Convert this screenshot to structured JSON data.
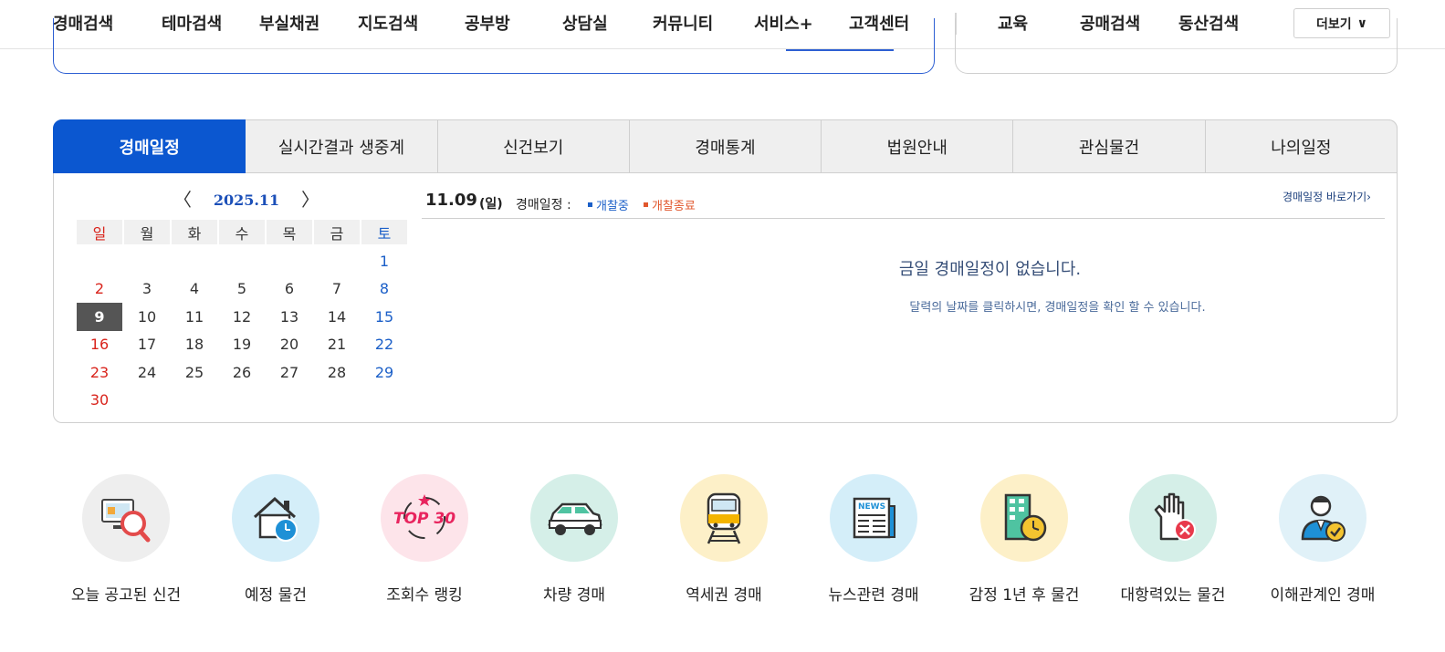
{
  "nav": {
    "items": [
      "경매검색",
      "테마검색",
      "부실채권",
      "지도검색",
      "공부방",
      "상담실",
      "커뮤니티",
      "서비스+",
      "고객센터"
    ],
    "extra": [
      "교육",
      "공매검색",
      "동산검색"
    ],
    "more_label": "더보기",
    "more_chevron": "∨"
  },
  "tabs": [
    "경매일정",
    "실시간결과 생중계",
    "신건보기",
    "경매통계",
    "법원안내",
    "관심물건",
    "나의일정"
  ],
  "active_tab": 0,
  "calendar": {
    "prev": "〈",
    "next": "〉",
    "month": "2025.11",
    "dow": [
      "일",
      "월",
      "화",
      "수",
      "목",
      "금",
      "토"
    ],
    "weeks": [
      [
        "",
        "",
        "",
        "",
        "",
        "",
        "1"
      ],
      [
        "2",
        "3",
        "4",
        "5",
        "6",
        "7",
        "8"
      ],
      [
        "9",
        "10",
        "11",
        "12",
        "13",
        "14",
        "15"
      ],
      [
        "16",
        "17",
        "18",
        "19",
        "20",
        "21",
        "22"
      ],
      [
        "23",
        "24",
        "25",
        "26",
        "27",
        "28",
        "29"
      ],
      [
        "30",
        "",
        "",
        "",
        "",
        "",
        ""
      ]
    ],
    "selected": "9"
  },
  "schedule": {
    "date": "11.09",
    "dow": "(일)",
    "label": "경매일정 :",
    "legend_open": "개찰중",
    "legend_closed": "개찰종료",
    "goto_link": "경매일정 바로가기›",
    "empty_title": "금일 경매일정이 없습니다.",
    "empty_sub": "달력의 날짜를 클릭하시면, 경매일정을 확인 할 수 있습니다."
  },
  "quick": [
    {
      "label": "오늘 공고된 신건",
      "icon": "monitor-search-icon",
      "bg": "#eeeeee"
    },
    {
      "label": "예정 물건",
      "icon": "house-clock-icon",
      "bg": "#d4eef9"
    },
    {
      "label": "조회수 랭킹",
      "icon": "top30-icon",
      "bg": "#fde4ea",
      "icon_text": "TOP 30"
    },
    {
      "label": "차량 경매",
      "icon": "car-icon",
      "bg": "#d5efe8"
    },
    {
      "label": "역세권 경매",
      "icon": "train-icon",
      "bg": "#fdf0c8"
    },
    {
      "label": "뉴스관련 경매",
      "icon": "newspaper-icon",
      "bg": "#d4eef9",
      "icon_text": "NEWS"
    },
    {
      "label": "감정 1년 후 물건",
      "icon": "building-clock-icon",
      "bg": "#fdf0c8"
    },
    {
      "label": "대항력있는 물건",
      "icon": "hand-stop-icon",
      "bg": "#d5efe8"
    },
    {
      "label": "이해관계인 경매",
      "icon": "person-check-icon",
      "bg": "#e0f1f8"
    }
  ],
  "colors": {
    "accent": "#0b57d0",
    "sunday": "#d9241c",
    "saturday": "#1b5fc8",
    "selected_day": "#555555"
  }
}
